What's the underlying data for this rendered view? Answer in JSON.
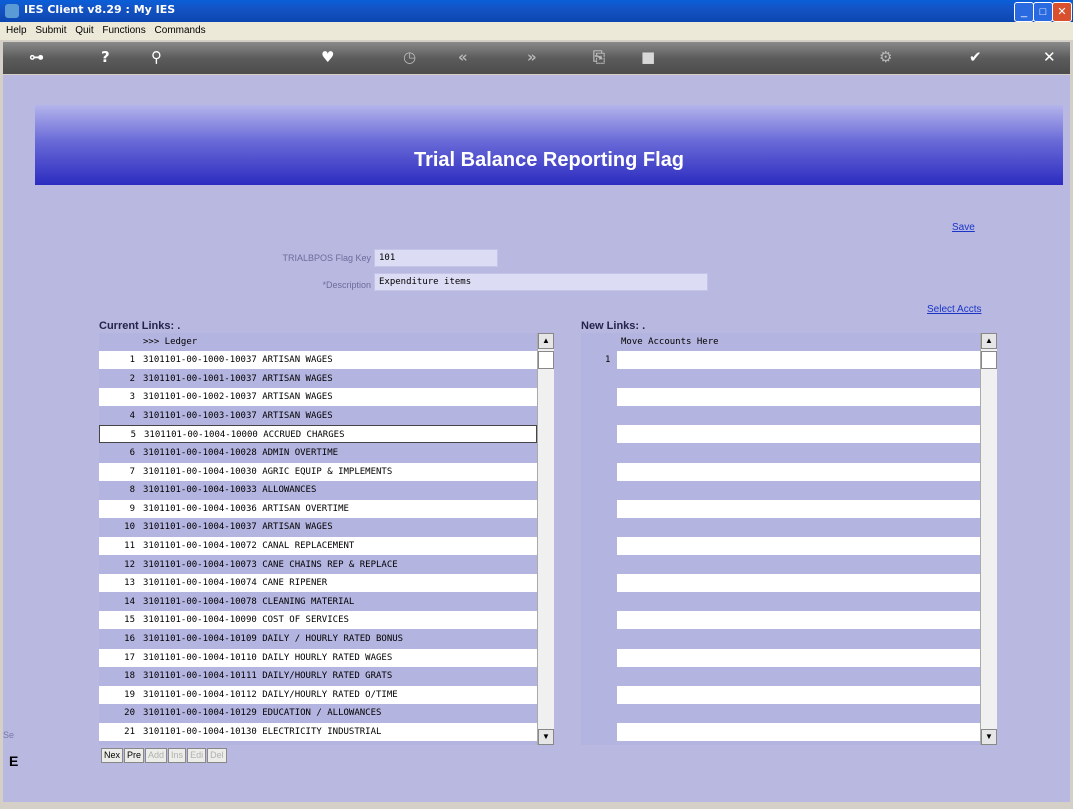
{
  "window": {
    "title": "IES Client v8.29 : My IES"
  },
  "menu": [
    "Help",
    "Submit",
    "Quit",
    "Functions",
    "Commands"
  ],
  "toolbar": [
    {
      "name": "key-icon",
      "glyph": "⊶"
    },
    {
      "name": "help-icon",
      "glyph": "?"
    },
    {
      "name": "search-icon",
      "glyph": "⚲"
    },
    {
      "name": "heart-icon",
      "glyph": "♥"
    },
    {
      "name": "clock-icon",
      "glyph": "◷"
    },
    {
      "name": "rewind-icon",
      "glyph": "«"
    },
    {
      "name": "forward-icon",
      "glyph": "»"
    },
    {
      "name": "pages-icon",
      "glyph": "⎘"
    },
    {
      "name": "stop-icon",
      "glyph": "■"
    },
    {
      "name": "settings-icon",
      "glyph": "⚙"
    },
    {
      "name": "check-icon",
      "glyph": "✔"
    },
    {
      "name": "close-icon",
      "glyph": "✕"
    }
  ],
  "page": {
    "title": "Trial Balance Reporting Flag"
  },
  "actions": {
    "save": "Save",
    "select_accts": "Select Accts"
  },
  "form": {
    "flag_key_label": "TRIALBPOS Flag Key",
    "flag_key_value": "101",
    "description_label": "*Description",
    "description_value": "Expenditure items"
  },
  "current_links": {
    "label": "Current Links: .",
    "header": ">>> Ledger",
    "rows": [
      {
        "num": "1",
        "text": "3101101-00-1000-10037 ARTISAN WAGES"
      },
      {
        "num": "2",
        "text": "3101101-00-1001-10037 ARTISAN WAGES"
      },
      {
        "num": "3",
        "text": "3101101-00-1002-10037 ARTISAN WAGES"
      },
      {
        "num": "4",
        "text": "3101101-00-1003-10037 ARTISAN WAGES"
      },
      {
        "num": "5",
        "text": "3101101-00-1004-10000 ACCRUED CHARGES"
      },
      {
        "num": "6",
        "text": "3101101-00-1004-10028 ADMIN OVERTIME"
      },
      {
        "num": "7",
        "text": "3101101-00-1004-10030 AGRIC EQUIP & IMPLEMENTS"
      },
      {
        "num": "8",
        "text": "3101101-00-1004-10033 ALLOWANCES"
      },
      {
        "num": "9",
        "text": "3101101-00-1004-10036 ARTISAN OVERTIME"
      },
      {
        "num": "10",
        "text": "3101101-00-1004-10037 ARTISAN WAGES"
      },
      {
        "num": "11",
        "text": "3101101-00-1004-10072 CANAL REPLACEMENT"
      },
      {
        "num": "12",
        "text": "3101101-00-1004-10073 CANE CHAINS REP & REPLACE"
      },
      {
        "num": "13",
        "text": "3101101-00-1004-10074 CANE RIPENER"
      },
      {
        "num": "14",
        "text": "3101101-00-1004-10078 CLEANING MATERIAL"
      },
      {
        "num": "15",
        "text": "3101101-00-1004-10090 COST OF SERVICES"
      },
      {
        "num": "16",
        "text": "3101101-00-1004-10109 DAILY / HOURLY RATED BONUS"
      },
      {
        "num": "17",
        "text": "3101101-00-1004-10110 DAILY HOURLY RATED WAGES"
      },
      {
        "num": "18",
        "text": "3101101-00-1004-10111 DAILY/HOURLY RATED GRATS"
      },
      {
        "num": "19",
        "text": "3101101-00-1004-10112 DAILY/HOURLY RATED O/TIME"
      },
      {
        "num": "20",
        "text": "3101101-00-1004-10129 EDUCATION / ALLOWANCES"
      },
      {
        "num": "21",
        "text": "3101101-00-1004-10130 ELECTRICITY INDUSTRIAL"
      }
    ]
  },
  "new_links": {
    "label": "New Links: .",
    "header": "Move Accounts Here",
    "first_row_num": "1"
  },
  "nav_buttons": [
    {
      "label": "Nex",
      "enabled": true
    },
    {
      "label": "Pre",
      "enabled": true
    },
    {
      "label": "Add",
      "enabled": false
    },
    {
      "label": "Ins",
      "enabled": false
    },
    {
      "label": "Edi",
      "enabled": false
    },
    {
      "label": "Del",
      "enabled": false
    }
  ],
  "side": {
    "label_top": "Se",
    "label_bottom": "E"
  }
}
